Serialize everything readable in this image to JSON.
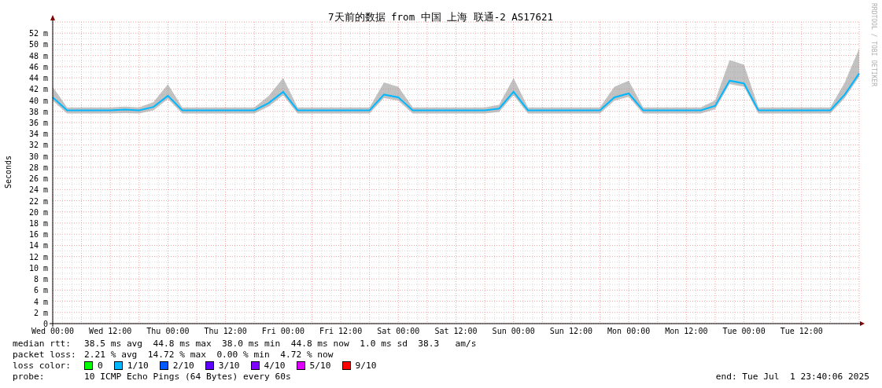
{
  "chart": {
    "chart_data": {
      "type": "line",
      "title": "7天前的数据 from 中国 上海 联通-2 AS17621",
      "ylabel": "Seconds",
      "grid": true,
      "ylim": [
        0,
        54
      ],
      "categories": [
        "Wed 00:00",
        null,
        null,
        null,
        "Wed 12:00",
        null,
        null,
        null,
        "Thu 00:00",
        null,
        null,
        null,
        "Thu 12:00",
        null,
        null,
        null,
        "Fri 00:00",
        null,
        null,
        null,
        "Fri 12:00",
        null,
        null,
        null,
        "Sat 00:00",
        null,
        null,
        null,
        "Sat 12:00",
        null,
        null,
        null,
        "Sun 00:00",
        null,
        null,
        null,
        "Sun 12:00",
        null,
        null,
        null,
        "Mon 00:00",
        null,
        null,
        null,
        "Mon 12:00",
        null,
        null,
        null,
        "Tue 00:00",
        null,
        null,
        null,
        "Tue 12:00",
        null,
        null,
        null,
        null
      ],
      "series": [
        {
          "color": "#00b8ff",
          "values": [
            40.5,
            38.2,
            38.2,
            38.2,
            38.2,
            38.3,
            38.2,
            38.8,
            40.8,
            38.2,
            38.2,
            38.2,
            38.2,
            38.2,
            38.2,
            39.5,
            41.5,
            38.2,
            38.2,
            38.2,
            38.2,
            38.2,
            38.2,
            41,
            40.5,
            38.2,
            38.2,
            38.2,
            38.2,
            38.2,
            38.2,
            38.5,
            41.5,
            38.2,
            38.2,
            38.2,
            38.2,
            38.2,
            38.2,
            40.5,
            41.2,
            38.2,
            38.2,
            38.2,
            38.2,
            38.2,
            39,
            43.5,
            43,
            38.2,
            38.2,
            38.2,
            38.2,
            38.2,
            38.2,
            41,
            44.8
          ]
        }
      ],
      "yticks": [
        {
          "value": 0,
          "label": "0"
        },
        {
          "value": 2,
          "label": "2 m"
        },
        {
          "value": 4,
          "label": "4 m"
        },
        {
          "value": 6,
          "label": "6 m"
        },
        {
          "value": 8,
          "label": "8 m"
        },
        {
          "value": 10,
          "label": "10 m"
        },
        {
          "value": 12,
          "label": "12 m"
        },
        {
          "value": 14,
          "label": "14 m"
        },
        {
          "value": 16,
          "label": "16 m"
        },
        {
          "value": 18,
          "label": "18 m"
        },
        {
          "value": 20,
          "label": "20 m"
        },
        {
          "value": 22,
          "label": "22 m"
        },
        {
          "value": 24,
          "label": "24 m"
        },
        {
          "value": 26,
          "label": "26 m"
        },
        {
          "value": 28,
          "label": "28 m"
        },
        {
          "value": 30,
          "label": "30 m"
        },
        {
          "value": 32,
          "label": "32 m"
        },
        {
          "value": 34,
          "label": "34 m"
        },
        {
          "value": 36,
          "label": "36 m"
        },
        {
          "value": 38,
          "label": "38 m"
        },
        {
          "value": 40,
          "label": "40 m"
        },
        {
          "value": 42,
          "label": "42 m"
        },
        {
          "value": 44,
          "label": "44 m"
        },
        {
          "value": 46,
          "label": "46 m"
        },
        {
          "value": 48,
          "label": "48 m"
        },
        {
          "value": 50,
          "label": "50 m"
        },
        {
          "value": 52,
          "label": "52 m"
        }
      ]
    },
    "credit": "RRDTOOL / TOBI OETIKER"
  },
  "legend": {
    "median_rtt": {
      "label": "median rtt:",
      "value": "38.5 ms avg  44.8 ms max  38.0 ms min  44.8 ms now  1.0 ms sd  38.3   am/s"
    },
    "packet_loss": {
      "label": "packet loss:",
      "value": "2.21 % avg  14.72 % max  0.00 % min  4.72 % now"
    },
    "loss_color": {
      "label": "loss color:",
      "items": [
        {
          "label": "0",
          "color": "#00ff00"
        },
        {
          "label": "1/10",
          "color": "#00b8ff"
        },
        {
          "label": "2/10",
          "color": "#0059ff"
        },
        {
          "label": "3/10",
          "color": "#5e00ff"
        },
        {
          "label": "4/10",
          "color": "#7e00ff"
        },
        {
          "label": "5/10",
          "color": "#dd00ff"
        },
        {
          "label": "9/10",
          "color": "#ff0000"
        }
      ]
    },
    "probe": {
      "label": "probe:",
      "value": "10 ICMP Echo Pings (64 Bytes) every 60s"
    },
    "end": "end: Tue Jul  1 23:40:06 2025"
  }
}
